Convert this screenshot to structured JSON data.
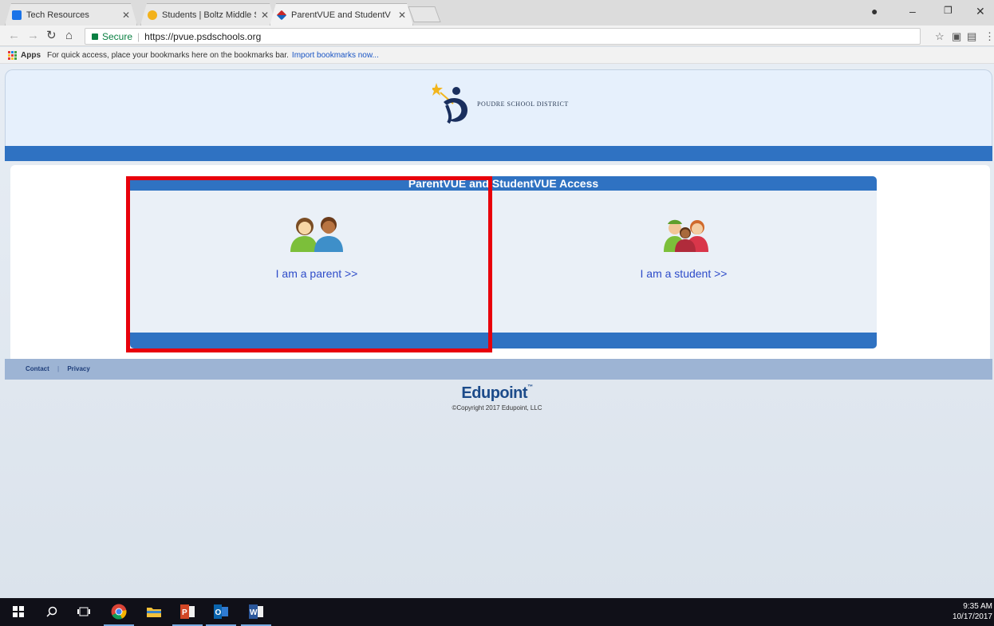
{
  "browser": {
    "tabs": [
      {
        "title": "Tech Resources",
        "favicon": "sheets-icon",
        "active": false
      },
      {
        "title": "Students | Boltz Middle S",
        "favicon": "school-crest-icon",
        "active": false
      },
      {
        "title": "ParentVUE and StudentV",
        "favicon": "vue-diamond-icon",
        "active": true
      }
    ],
    "address": {
      "secure_label": "Secure",
      "url": "https://pvue.psdschools.org"
    },
    "bookmarks": {
      "apps_label": "Apps",
      "hint": "For quick access, place your bookmarks here on the bookmarks bar.",
      "import_link": "Import bookmarks now..."
    }
  },
  "page": {
    "district_name": "POUDRE SCHOOL DISTRICT",
    "access_title": "ParentVUE and StudentVUE Access",
    "parent_link": "I am a parent >>",
    "student_link": "I am a student >>",
    "footer": {
      "contact": "Contact",
      "divider": "|",
      "privacy": "Privacy"
    },
    "brand": "Edupoint",
    "trademark": "™",
    "copyright": "©Copyright 2017 Edupoint, LLC"
  },
  "annotation": {
    "highlight_color": "#e8000b",
    "target": "parent option"
  },
  "taskbar": {
    "apps": [
      "windows-start-icon",
      "search-icon",
      "task-view-icon",
      "chrome-icon",
      "file-explorer-icon",
      "powerpoint-icon",
      "outlook-icon",
      "word-icon"
    ],
    "time": "9:35 AM",
    "date": "10/17/2017"
  },
  "colors": {
    "accent_blue": "#2f72c2",
    "link_blue": "#2e4cc9",
    "footer_bar": "#9db4d4"
  }
}
